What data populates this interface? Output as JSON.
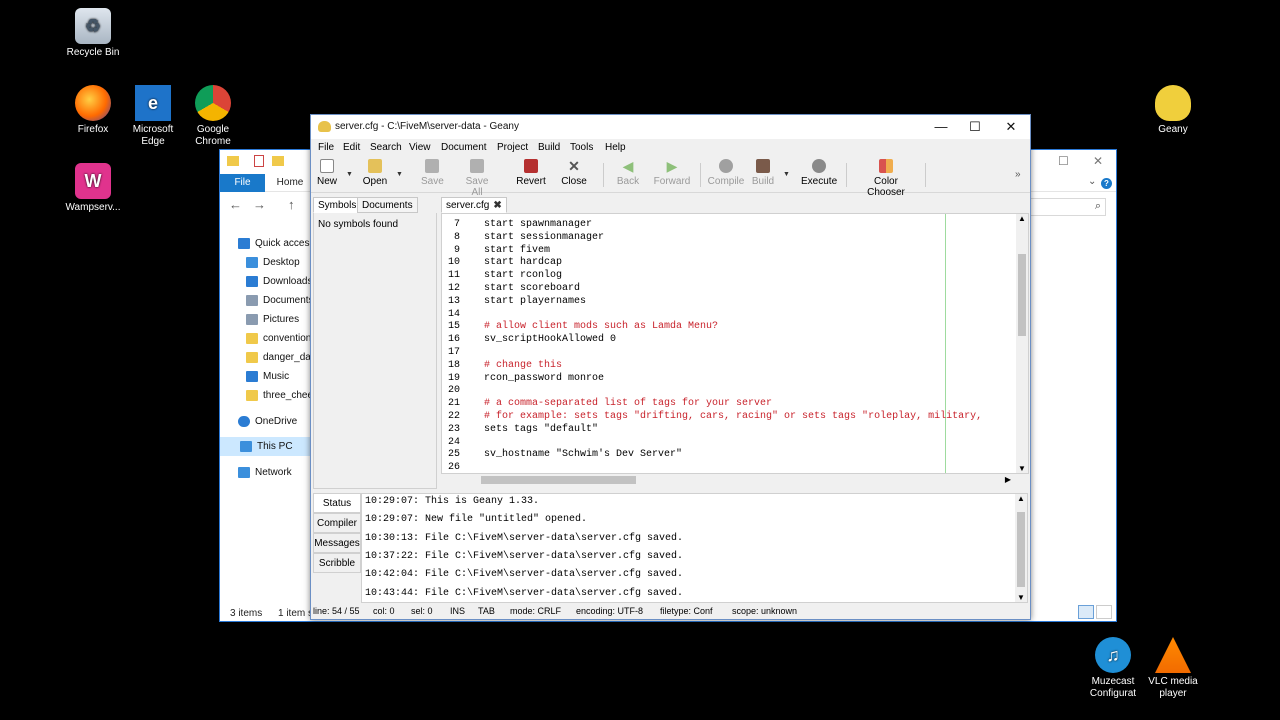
{
  "desktop": {
    "icons": [
      {
        "label": "Recycle Bin",
        "icon": "recycle-bin-icon"
      },
      {
        "label": "Firefox",
        "icon": "firefox-icon"
      },
      {
        "label": "Microsoft\nEdge",
        "icon": "edge-icon"
      },
      {
        "label": "Google\nChrome",
        "icon": "chrome-icon"
      },
      {
        "label": "Wampserv...",
        "icon": "wampserver-icon"
      },
      {
        "label": "Geany",
        "icon": "geany-icon"
      },
      {
        "label": "Muzecast\nConfigurat",
        "icon": "muzecast-icon"
      },
      {
        "label": "VLC media\nplayer",
        "icon": "vlc-icon"
      }
    ]
  },
  "explorer": {
    "ribbon": {
      "file": "File",
      "home": "Home"
    },
    "sidebar": [
      {
        "label": "Quick access",
        "icon": "star-icon",
        "color": "#2b7cd3"
      },
      {
        "label": "Desktop",
        "icon": "desktop-folder-icon",
        "color": "#3b8fdc"
      },
      {
        "label": "Downloads",
        "icon": "downloads-folder-icon",
        "color": "#2b7cd3"
      },
      {
        "label": "Documents",
        "icon": "documents-folder-icon",
        "color": "#8a9bb0"
      },
      {
        "label": "Pictures",
        "icon": "pictures-folder-icon",
        "color": "#8a9bb0"
      },
      {
        "label": "convention",
        "icon": "folder-icon",
        "color": "#f0c94a"
      },
      {
        "label": "danger_day",
        "icon": "folder-icon",
        "color": "#f0c94a"
      },
      {
        "label": "Music",
        "icon": "music-folder-icon",
        "color": "#2b7cd3"
      },
      {
        "label": "three_cheer",
        "icon": "folder-icon",
        "color": "#f0c94a"
      },
      {
        "label": "OneDrive",
        "icon": "onedrive-icon",
        "color": "#2b7cd3"
      },
      {
        "label": "This PC",
        "icon": "pc-icon",
        "color": "#3b8fdc"
      },
      {
        "label": "Network",
        "icon": "network-icon",
        "color": "#3b8fdc"
      }
    ],
    "status": {
      "items": "3 items",
      "selected": "1 item s"
    }
  },
  "geany": {
    "title": "server.cfg - C:\\FiveM\\server-data - Geany",
    "menu": [
      "File",
      "Edit",
      "Search",
      "View",
      "Document",
      "Project",
      "Build",
      "Tools",
      "Help"
    ],
    "toolbar": [
      {
        "label": "New",
        "enabled": true,
        "color": "#ffffff"
      },
      {
        "label": "Open",
        "enabled": true,
        "color": "#e4c15a"
      },
      {
        "label": "Save",
        "enabled": false,
        "color": "#b0b0b0"
      },
      {
        "label": "Save All",
        "enabled": false,
        "color": "#b0b0b0"
      },
      {
        "label": "Revert",
        "enabled": true,
        "color": "#b53030"
      },
      {
        "label": "Close",
        "enabled": true,
        "color": "#555555"
      },
      {
        "label": "Back",
        "enabled": false,
        "color": "#8ec07a"
      },
      {
        "label": "Forward",
        "enabled": false,
        "color": "#8ec07a"
      },
      {
        "label": "Compile",
        "enabled": false,
        "color": "#a0a0a0"
      },
      {
        "label": "Build",
        "enabled": false,
        "color": "#7a5a4a"
      },
      {
        "label": "Execute",
        "enabled": true,
        "color": "#8a8a8a"
      },
      {
        "label": "Color Chooser",
        "enabled": true,
        "color": "#d9534f"
      }
    ],
    "sidebar": {
      "tabs": [
        "Symbols",
        "Documents"
      ],
      "empty_text": "No symbols found"
    },
    "editor": {
      "tab": "server.cfg",
      "lines": [
        {
          "n": "7",
          "text": "start spawnmanager",
          "comment": false
        },
        {
          "n": "8",
          "text": "start sessionmanager",
          "comment": false
        },
        {
          "n": "9",
          "text": "start fivem",
          "comment": false
        },
        {
          "n": "10",
          "text": "start hardcap",
          "comment": false
        },
        {
          "n": "11",
          "text": "start rconlog",
          "comment": false
        },
        {
          "n": "12",
          "text": "start scoreboard",
          "comment": false
        },
        {
          "n": "13",
          "text": "start playernames",
          "comment": false
        },
        {
          "n": "14",
          "text": "",
          "comment": false
        },
        {
          "n": "15",
          "text": "# allow client mods such as Lamda Menu?",
          "comment": true
        },
        {
          "n": "16",
          "text": "sv_scriptHookAllowed 0",
          "comment": false
        },
        {
          "n": "17",
          "text": "",
          "comment": false
        },
        {
          "n": "18",
          "text": "# change this",
          "comment": true
        },
        {
          "n": "19",
          "text": "rcon_password monroe",
          "comment": false
        },
        {
          "n": "20",
          "text": "",
          "comment": false
        },
        {
          "n": "21",
          "text": "# a comma-separated list of tags for your server",
          "comment": true
        },
        {
          "n": "22",
          "text": "# for example: sets tags \"drifting, cars, racing\" or sets tags \"roleplay, military,",
          "comment": true
        },
        {
          "n": "23",
          "text": "sets tags \"default\"",
          "comment": false
        },
        {
          "n": "24",
          "text": "",
          "comment": false
        },
        {
          "n": "25",
          "text": "sv_hostname \"Schwim's Dev Server\"",
          "comment": false
        },
        {
          "n": "26",
          "text": "",
          "comment": false
        }
      ]
    },
    "messages": {
      "tabs": [
        "Status",
        "Compiler",
        "Messages",
        "Scribble"
      ],
      "lines": [
        "10:29:07: This is Geany 1.33.",
        "10:29:07: New file \"untitled\" opened.",
        "10:30:13: File C:\\FiveM\\server-data\\server.cfg saved.",
        "10:37:22: File C:\\FiveM\\server-data\\server.cfg saved.",
        "10:42:04: File C:\\FiveM\\server-data\\server.cfg saved.",
        "10:43:44: File C:\\FiveM\\server-data\\server.cfg saved."
      ]
    },
    "statusbar": {
      "line": "line: 54 / 55",
      "col": "col: 0",
      "sel": "sel: 0",
      "ins": "INS",
      "tab": "TAB",
      "mode": "mode: CRLF",
      "encoding": "encoding: UTF-8",
      "filetype": "filetype: Conf",
      "scope": "scope: unknown"
    }
  }
}
